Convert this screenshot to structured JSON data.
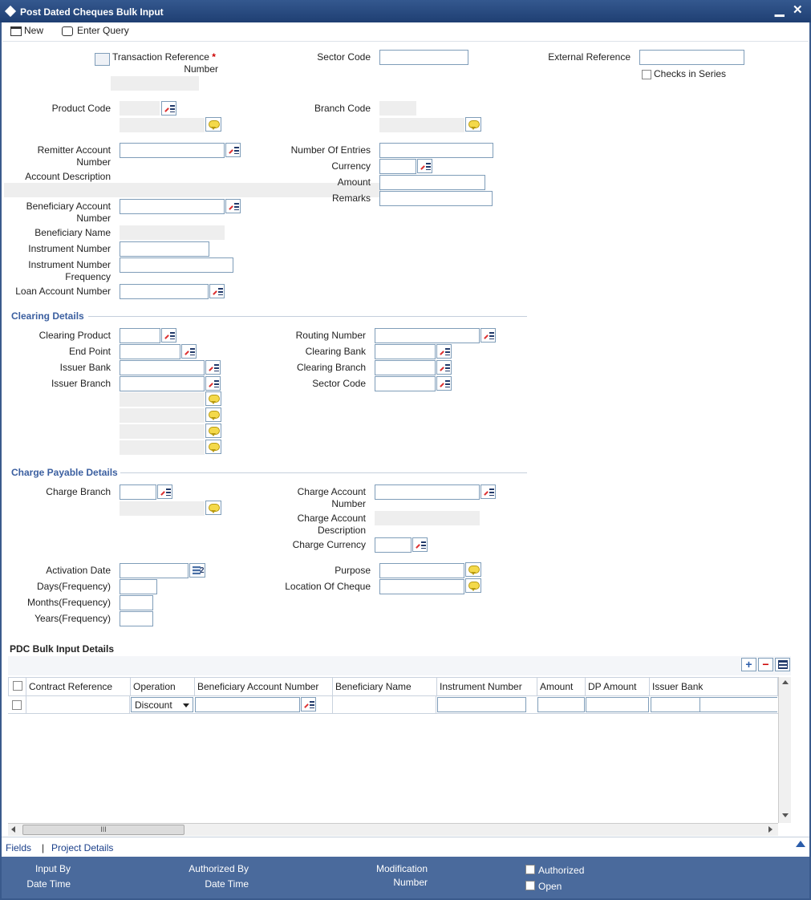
{
  "window": {
    "title": "Post Dated Cheques Bulk Input",
    "minimize": "▁",
    "close": "✕"
  },
  "toolbar": {
    "new_label": "New",
    "enter_query_label": "Enter Query"
  },
  "header": {
    "transaction_reference": "Transaction Reference",
    "transaction_reference_2": "Number",
    "required_mark": "*",
    "sector_code": "Sector Code",
    "external_reference": "External Reference",
    "checks_in_series": "Checks in Series",
    "product_code": "Product Code",
    "branch_code": "Branch Code"
  },
  "remitter": {
    "account_1": "Remitter Account",
    "account_2": "Number",
    "account_description": "Account Description",
    "number_of_entries": "Number Of Entries",
    "currency": "Currency",
    "amount": "Amount",
    "remarks": "Remarks",
    "beneficiary_account_1": "Beneficiary Account",
    "beneficiary_account_2": "Number",
    "beneficiary_name": "Beneficiary Name",
    "instrument_number": "Instrument Number",
    "instrument_frequency_1": "Instrument Number",
    "instrument_frequency_2": "Frequency",
    "loan_account_number": "Loan Account Number"
  },
  "clearing": {
    "title": "Clearing Details",
    "clearing_product": "Clearing Product",
    "end_point": "End Point",
    "issuer_bank": "Issuer Bank",
    "issuer_branch": "Issuer Branch",
    "routing_number": "Routing Number",
    "clearing_bank": "Clearing Bank",
    "clearing_branch": "Clearing Branch",
    "sector_code": "Sector Code"
  },
  "charge": {
    "title": "Charge Payable Details",
    "charge_branch": "Charge Branch",
    "charge_account_1": "Charge Account",
    "charge_account_2": "Number",
    "charge_desc_1": "Charge Account",
    "charge_desc_2": "Description",
    "charge_currency": "Charge Currency"
  },
  "schedule": {
    "activation_date": "Activation Date",
    "days": "Days(Frequency)",
    "months": "Months(Frequency)",
    "years": "Years(Frequency)",
    "purpose": "Purpose",
    "location_of_cheque": "Location Of Cheque"
  },
  "grid": {
    "title": "PDC Bulk Input Details",
    "add": "+",
    "remove": "−",
    "columns": [
      "Contract Reference",
      "Operation",
      "Beneficiary Account Number",
      "Beneficiary Name",
      "Instrument Number",
      "Amount",
      "DP Amount",
      "Issuer Bank"
    ],
    "row_operation": "Discount",
    "scroll_grip": "III"
  },
  "links": {
    "fields": "Fields",
    "separator": "|",
    "project_details": "Project Details"
  },
  "footer": {
    "input_by": "Input By",
    "date_time_1": "Date Time",
    "authorized_by": "Authorized By",
    "date_time_2": "Date Time",
    "modification_1": "Modification",
    "modification_2": "Number",
    "authorized": "Authorized",
    "open": "Open"
  }
}
